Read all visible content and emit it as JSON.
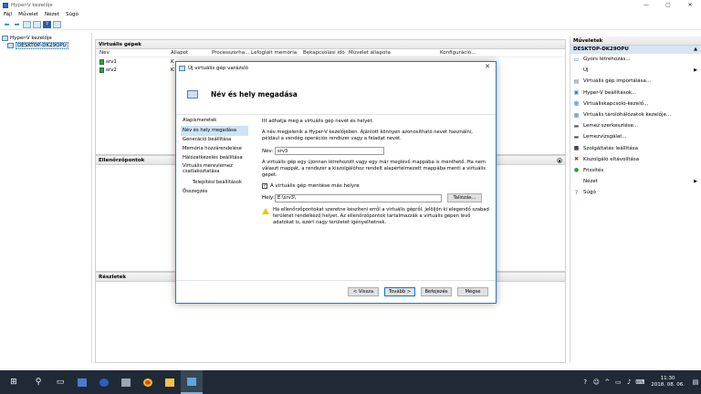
{
  "window": {
    "title": "Hyper-V kezelője",
    "controls": [
      "—",
      "▢",
      "✕"
    ]
  },
  "menu": [
    "Fájl",
    "Művelet",
    "Nézet",
    "Súgó"
  ],
  "tree": {
    "root": "Hyper-V kezelője",
    "host": "DESKTOP-DK29OPU"
  },
  "vm_panel": {
    "title": "Virtuális gépek",
    "columns": [
      "Név",
      "Állapot",
      "Processzorha...",
      "Lefoglalt memória",
      "Bekapcsolási idő",
      "Művelet állapota",
      "Konfiguráció..."
    ],
    "rows": [
      {
        "name": "srv1",
        "state": "K"
      },
      {
        "name": "srv2",
        "state": "K"
      }
    ]
  },
  "checkpoints_panel": {
    "title": "Ellenőrzőpontok"
  },
  "details_panel": {
    "title": "Részletek"
  },
  "actions": {
    "title": "Műveletek",
    "host": "DESKTOP-DK29OPU",
    "items": [
      {
        "label": "Gyors létrehozás...",
        "icon": "quick-create-icon",
        "arrow": false
      },
      {
        "label": "Új",
        "icon": "",
        "arrow": true
      },
      {
        "label": "Virtuális gép importálása...",
        "icon": "import-icon",
        "arrow": false
      },
      {
        "label": "Hyper-V beállítások...",
        "icon": "settings-icon",
        "arrow": false
      },
      {
        "label": "Virtuáliskapcsoló-kezelő...",
        "icon": "switch-icon",
        "arrow": false
      },
      {
        "label": "Virtuális tárolóhálózatok kezelője...",
        "icon": "san-icon",
        "arrow": false
      },
      {
        "label": "Lemez szerkesztése...",
        "icon": "edit-disk-icon",
        "arrow": false
      },
      {
        "label": "Lemezvizsgálat...",
        "icon": "inspect-disk-icon",
        "arrow": false
      },
      {
        "label": "Szolgáltatás leállítása",
        "icon": "stop-icon",
        "arrow": false
      },
      {
        "label": "Kiszolgáló eltávolítása",
        "icon": "remove-icon",
        "arrow": false
      },
      {
        "label": "Frissítés",
        "icon": "refresh-icon",
        "arrow": false
      },
      {
        "label": "Nézet",
        "icon": "",
        "arrow": true
      },
      {
        "label": "Súgó",
        "icon": "help-icon",
        "arrow": false
      }
    ]
  },
  "dialog": {
    "title": "Új virtuális gép varázsló",
    "heading": "Név és hely megadása",
    "nav": [
      {
        "label": "Alapismeretek",
        "sel": false,
        "sub": false,
        "two": false
      },
      {
        "label": "Név és hely megadása",
        "sel": true,
        "sub": false,
        "two": false
      },
      {
        "label": "Generáció beállítása",
        "sel": false,
        "sub": false,
        "two": false
      },
      {
        "label": "Memória hozzárendelése",
        "sel": false,
        "sub": false,
        "two": false
      },
      {
        "label": "Hálózatkezelés beállítása",
        "sel": false,
        "sub": false,
        "two": false
      },
      {
        "label": "Virtuális merevlemez csatlakoztatása",
        "sel": false,
        "sub": false,
        "two": true
      },
      {
        "label": "Telepítési beállítások",
        "sel": false,
        "sub": true,
        "two": false
      },
      {
        "label": "Összegzés",
        "sel": false,
        "sub": false,
        "two": false
      }
    ],
    "intro": "Itt adhatja meg a virtuális gép nevét és helyét.",
    "name_desc": "A név megjelenik a Hyper-V kezelőjében. Ajánlott könnyen azonosítható nevet használni, például a vendég operációs rendszer vagy a feladat nevét.",
    "name_label": "Név:",
    "name_value": "srv3",
    "location_desc": "A virtuális gép egy újonnan létrehozott vagy egy már meglévő mappába is menthető. Ha nem választ mappát, a rendszer a kiszolgálóhoz rendelt alapértelmezett mappába menti a virtuális gépet.",
    "store_checkbox": "A virtuális gép mentése más helyre",
    "store_checked": true,
    "location_label": "Hely:",
    "location_value": "E:\\srv3\\",
    "browse": "Tallózás...",
    "warning": "Ha ellenőrzőpontokat szeretne készíteni erről a virtuális gépről, jelöljön ki elegendő szabad területet rendelkező helyet. Az ellenőrzőpontok tartalmazzák a virtuális gépen lévő adatokat is, ezért nagy területet igényelhetnek.",
    "buttons": {
      "back": "< Vissza",
      "next": "Tovább >",
      "finish": "Befejezés",
      "cancel": "Mégse"
    }
  },
  "taskbar": {
    "time": "11:30",
    "date": "2018. 08. 06."
  }
}
